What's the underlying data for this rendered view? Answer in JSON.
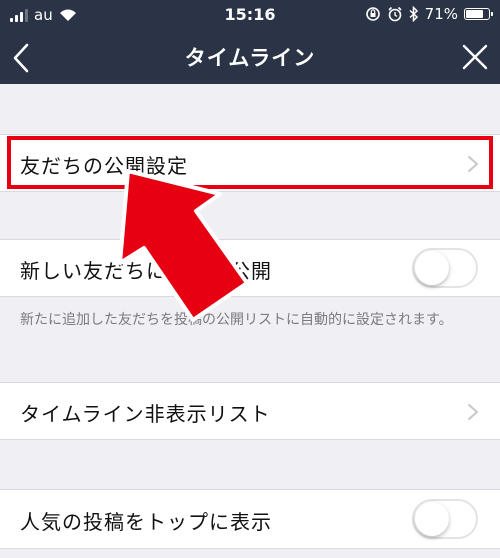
{
  "status_bar": {
    "carrier": "au",
    "time": "15:16",
    "battery": "71%"
  },
  "navbar": {
    "title": "タイムライン",
    "back_icon": "chevron-left-icon",
    "close_icon": "close-icon"
  },
  "rows": {
    "friends_privacy": {
      "label": "友だちの公開設定"
    },
    "new_friends_public": {
      "label": "新しい友だちに自動で公開",
      "toggle_on": false,
      "footnote": "新たに追加した友だちを投稿の公開リストに自動的に設定されます。"
    },
    "timeline_hidden_list": {
      "label": "タイムライン非表示リスト"
    },
    "popular_posts_top": {
      "label": "人気の投稿をトップに表示",
      "toggle_on": false
    }
  },
  "annotation": {
    "highlight_color": "#e60012",
    "arrow_color": "#e60012"
  }
}
